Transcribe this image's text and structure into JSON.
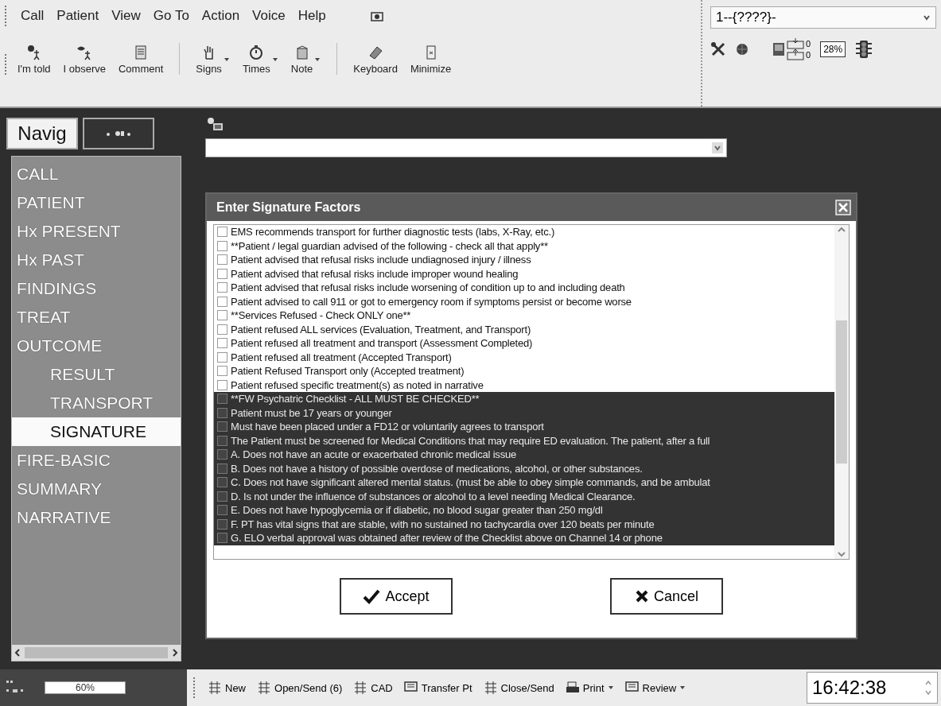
{
  "menu_bar": {
    "items": [
      "Call",
      "Patient",
      "View",
      "Go To",
      "Action",
      "Voice",
      "Help"
    ]
  },
  "toolbar": {
    "buttons": [
      {
        "label": "I'm told",
        "dropdown": false
      },
      {
        "label": "I observe",
        "dropdown": false
      },
      {
        "label": "Comment",
        "dropdown": false
      },
      {
        "label": "Signs",
        "dropdown": true
      },
      {
        "label": "Times",
        "dropdown": true
      },
      {
        "label": "Note",
        "dropdown": true
      },
      {
        "label": "Keyboard",
        "dropdown": false
      },
      {
        "label": "Minimize",
        "dropdown": false
      }
    ]
  },
  "session_select": {
    "value": "1--{????}-"
  },
  "status_indicators": {
    "in_count": "0",
    "out_count": "0",
    "percent": "28%"
  },
  "navigator": {
    "tabs": [
      {
        "label": "Navig",
        "kind": "text",
        "selected": true
      },
      {
        "kind": "icon",
        "selected": false
      }
    ],
    "items": [
      {
        "label": "CALL",
        "selected": false
      },
      {
        "label": "PATIENT",
        "selected": false
      },
      {
        "label": "Hx PRESENT",
        "selected": false
      },
      {
        "label": "Hx PAST",
        "selected": false
      },
      {
        "label": "FINDINGS",
        "selected": false
      },
      {
        "label": "TREAT",
        "selected": false
      },
      {
        "label": "OUTCOME",
        "selected": false,
        "children": [
          {
            "label": "RESULT",
            "selected": false
          },
          {
            "label": "TRANSPORT",
            "selected": false
          },
          {
            "label": "SIGNATURE",
            "selected": true
          }
        ]
      },
      {
        "label": "FIRE-BASIC",
        "selected": false
      },
      {
        "label": "SUMMARY",
        "selected": false
      },
      {
        "label": "NARRATIVE",
        "selected": false
      }
    ]
  },
  "dialog": {
    "title": "Enter Signature Factors",
    "items": [
      {
        "label": "EMS recommends transport for further diagnostic tests (labs, X-Ray, etc.)",
        "checked": false,
        "selected": false
      },
      {
        "label": "**Patient / legal guardian advised of the following - check all that apply**",
        "checked": false,
        "selected": false
      },
      {
        "label": "Patient advised that refusal risks include undiagnosed injury / illness",
        "checked": false,
        "selected": false
      },
      {
        "label": "Patient advised that refusal risks include improper wound healing",
        "checked": false,
        "selected": false
      },
      {
        "label": "Patient advised that refusal risks include worsening of condition up to and including death",
        "checked": false,
        "selected": false
      },
      {
        "label": "Patient advised to call 911 or got to emergency room if symptoms persist or become worse",
        "checked": false,
        "selected": false
      },
      {
        "label": "**Services Refused - Check ONLY one**",
        "checked": false,
        "selected": false
      },
      {
        "label": "Patient refused ALL services (Evaluation, Treatment, and Transport)",
        "checked": false,
        "selected": false
      },
      {
        "label": "Patient refused all treatment and transport (Assessment Completed)",
        "checked": false,
        "selected": false
      },
      {
        "label": "Patient refused all treatment (Accepted Transport)",
        "checked": false,
        "selected": false
      },
      {
        "label": "Patient Refused Transport only (Accepted treatment)",
        "checked": false,
        "selected": false
      },
      {
        "label": "Patient refused specific treatment(s) as noted in narrative",
        "checked": false,
        "selected": false
      },
      {
        "label": "**FW Psychatric Checklist - ALL MUST BE CHECKED**",
        "checked": false,
        "selected": true
      },
      {
        "label": "Patient must be 17 years or younger",
        "checked": false,
        "selected": true
      },
      {
        "label": "Must have been placed under a FD12 or voluntarily agrees to transport",
        "checked": false,
        "selected": true
      },
      {
        "label": "The Patient must be screened for Medical Conditions that may require ED evaluation. The patient, after a full",
        "checked": false,
        "selected": true
      },
      {
        "label": "A. Does not have an acute or exacerbated chronic medical issue",
        "checked": false,
        "selected": true
      },
      {
        "label": "B. Does not have a history of possible overdose of medications, alcohol, or other substances.",
        "checked": false,
        "selected": true
      },
      {
        "label": "C. Does not have significant altered mental status.   (must be able to obey simple commands, and be ambulat",
        "checked": false,
        "selected": true
      },
      {
        "label": "D. Is not under the influence of substances or alcohol to a level needing Medical Clearance.",
        "checked": false,
        "selected": true
      },
      {
        "label": "E. Does not have hypoglycemia or if diabetic, no blood sugar greater than 250 mg/dl",
        "checked": false,
        "selected": true
      },
      {
        "label": "F. PT has vital signs that are stable,  with no sustained no tachycardia over 120 beats per minute",
        "checked": false,
        "selected": true
      },
      {
        "label": "G.  ELO verbal approval was obtained after review of the Checklist above on Channel  14 or phone",
        "checked": false,
        "selected": true
      }
    ],
    "buttons": [
      {
        "label": "Accept",
        "kind": "accept"
      },
      {
        "label": "Cancel",
        "kind": "cancel"
      }
    ]
  },
  "status_bar": {
    "progress_text": "60%"
  },
  "taskbar": {
    "buttons": [
      {
        "label": "New",
        "dropdown": false
      },
      {
        "label": "Open/Send (6)",
        "dropdown": false
      },
      {
        "label": "CAD",
        "dropdown": false
      },
      {
        "label": "Transfer Pt",
        "dropdown": false
      },
      {
        "label": "Close/Send",
        "dropdown": false
      },
      {
        "label": "Print",
        "dropdown": true
      },
      {
        "label": "Review",
        "dropdown": true
      }
    ]
  },
  "clock": "16:42:38"
}
